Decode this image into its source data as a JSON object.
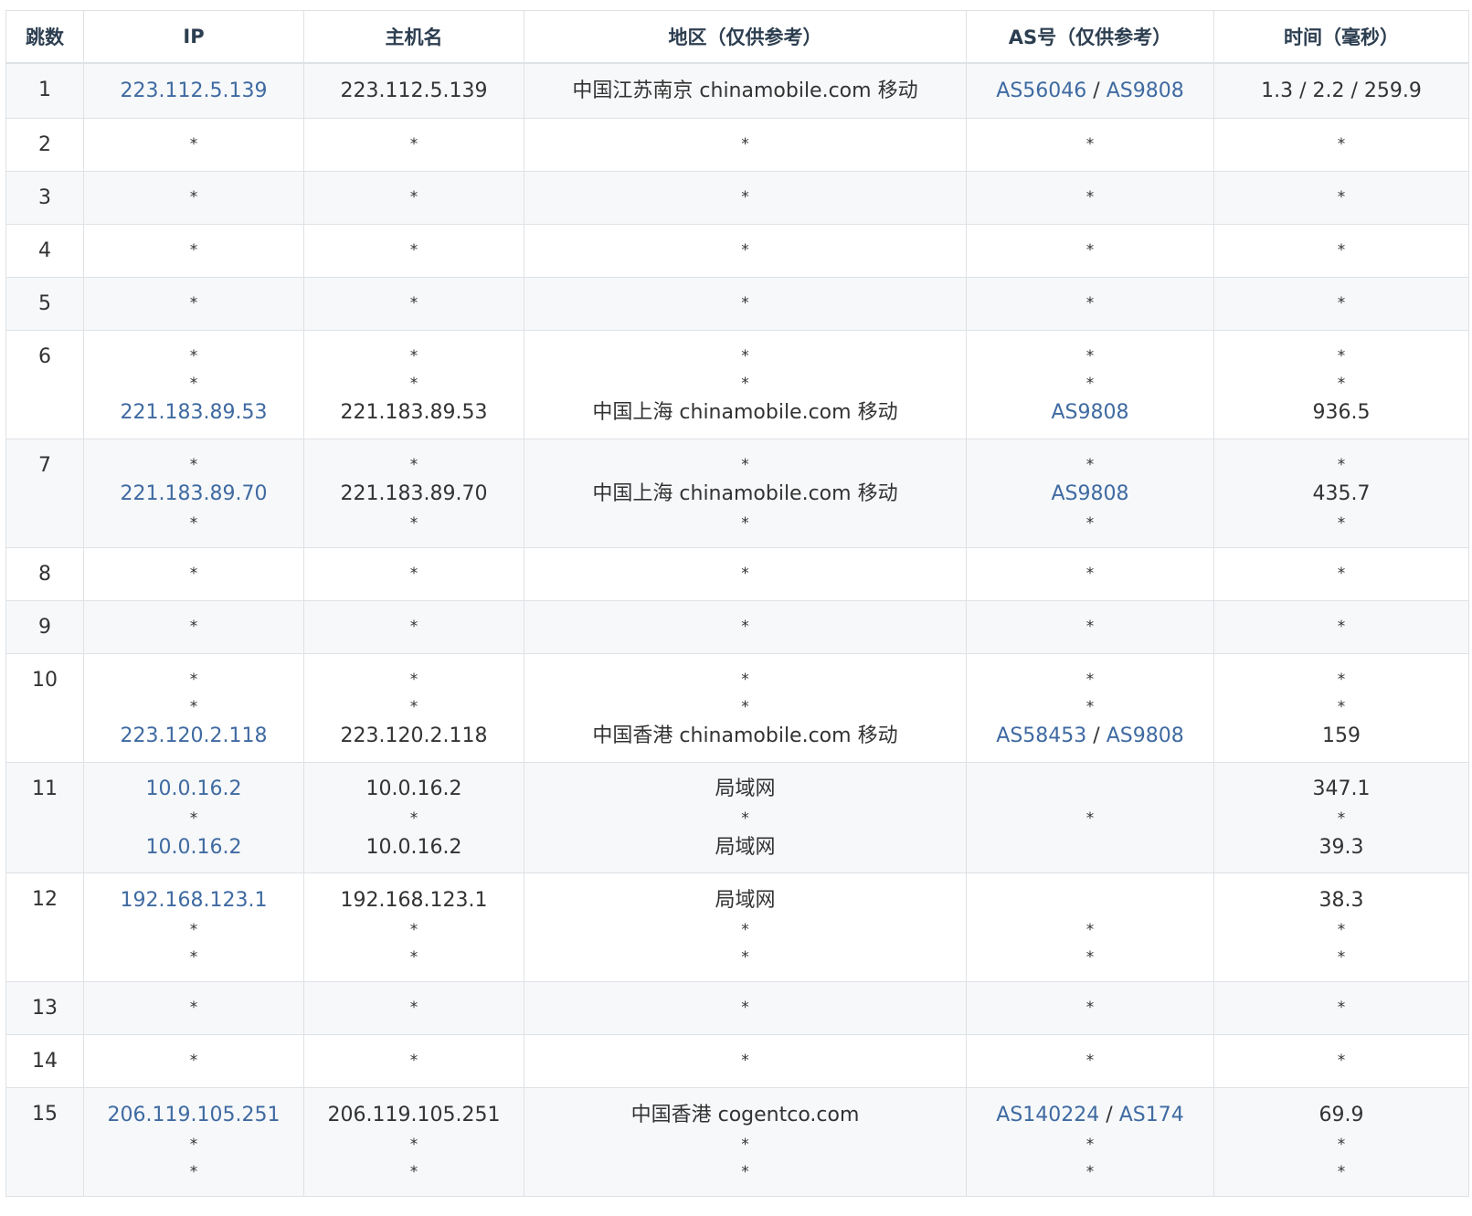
{
  "headers": [
    "跳数",
    "IP",
    "主机名",
    "地区（仅供参考）",
    "AS号（仅供参考）",
    "时间（毫秒）"
  ],
  "colors": {
    "link": "#3f6aa1",
    "text": "#333333",
    "header": "#2c3e50",
    "stripe": "#f6f8fa",
    "border": "#dfe2e5"
  },
  "rows": [
    {
      "hop": "1",
      "ip": [
        [
          "223.112.5.139"
        ]
      ],
      "host": [
        [
          "223.112.5.139"
        ]
      ],
      "region": [
        [
          "中国江苏南京 chinamobile.com 移动"
        ]
      ],
      "as": [
        [
          "AS56046",
          "AS9808"
        ]
      ],
      "time": [
        [
          "1.3 / 2.2 / 259.9"
        ]
      ]
    },
    {
      "hop": "2",
      "ip": [
        [
          "*"
        ]
      ],
      "host": [
        [
          "*"
        ]
      ],
      "region": [
        [
          "*"
        ]
      ],
      "as": [
        [
          "*"
        ]
      ],
      "time": [
        [
          "*"
        ]
      ]
    },
    {
      "hop": "3",
      "ip": [
        [
          "*"
        ]
      ],
      "host": [
        [
          "*"
        ]
      ],
      "region": [
        [
          "*"
        ]
      ],
      "as": [
        [
          "*"
        ]
      ],
      "time": [
        [
          "*"
        ]
      ]
    },
    {
      "hop": "4",
      "ip": [
        [
          "*"
        ]
      ],
      "host": [
        [
          "*"
        ]
      ],
      "region": [
        [
          "*"
        ]
      ],
      "as": [
        [
          "*"
        ]
      ],
      "time": [
        [
          "*"
        ]
      ]
    },
    {
      "hop": "5",
      "ip": [
        [
          "*"
        ]
      ],
      "host": [
        [
          "*"
        ]
      ],
      "region": [
        [
          "*"
        ]
      ],
      "as": [
        [
          "*"
        ]
      ],
      "time": [
        [
          "*"
        ]
      ]
    },
    {
      "hop": "6",
      "ip": [
        [
          "*"
        ],
        [
          "*"
        ],
        [
          "221.183.89.53"
        ]
      ],
      "host": [
        [
          "*"
        ],
        [
          "*"
        ],
        [
          "221.183.89.53"
        ]
      ],
      "region": [
        [
          "*"
        ],
        [
          "*"
        ],
        [
          "中国上海 chinamobile.com 移动"
        ]
      ],
      "as": [
        [
          "*"
        ],
        [
          "*"
        ],
        [
          "AS9808"
        ]
      ],
      "time": [
        [
          "*"
        ],
        [
          "*"
        ],
        [
          "936.5"
        ]
      ]
    },
    {
      "hop": "7",
      "ip": [
        [
          "*"
        ],
        [
          "221.183.89.70"
        ],
        [
          "*"
        ]
      ],
      "host": [
        [
          "*"
        ],
        [
          "221.183.89.70"
        ],
        [
          "*"
        ]
      ],
      "region": [
        [
          "*"
        ],
        [
          "中国上海 chinamobile.com 移动"
        ],
        [
          "*"
        ]
      ],
      "as": [
        [
          "*"
        ],
        [
          "AS9808"
        ],
        [
          "*"
        ]
      ],
      "time": [
        [
          "*"
        ],
        [
          "435.7"
        ],
        [
          "*"
        ]
      ]
    },
    {
      "hop": "8",
      "ip": [
        [
          "*"
        ]
      ],
      "host": [
        [
          "*"
        ]
      ],
      "region": [
        [
          "*"
        ]
      ],
      "as": [
        [
          "*"
        ]
      ],
      "time": [
        [
          "*"
        ]
      ]
    },
    {
      "hop": "9",
      "ip": [
        [
          "*"
        ]
      ],
      "host": [
        [
          "*"
        ]
      ],
      "region": [
        [
          "*"
        ]
      ],
      "as": [
        [
          "*"
        ]
      ],
      "time": [
        [
          "*"
        ]
      ]
    },
    {
      "hop": "10",
      "ip": [
        [
          "*"
        ],
        [
          "*"
        ],
        [
          "223.120.2.118"
        ]
      ],
      "host": [
        [
          "*"
        ],
        [
          "*"
        ],
        [
          "223.120.2.118"
        ]
      ],
      "region": [
        [
          "*"
        ],
        [
          "*"
        ],
        [
          "中国香港 chinamobile.com 移动"
        ]
      ],
      "as": [
        [
          "*"
        ],
        [
          "*"
        ],
        [
          "AS58453",
          "AS9808"
        ]
      ],
      "time": [
        [
          "*"
        ],
        [
          "*"
        ],
        [
          "159"
        ]
      ]
    },
    {
      "hop": "11",
      "ip": [
        [
          "10.0.16.2"
        ],
        [
          "*"
        ],
        [
          "10.0.16.2"
        ]
      ],
      "host": [
        [
          "10.0.16.2"
        ],
        [
          "*"
        ],
        [
          "10.0.16.2"
        ]
      ],
      "region": [
        [
          "局域网"
        ],
        [
          "*"
        ],
        [
          "局域网"
        ]
      ],
      "as": [
        [
          ""
        ],
        [
          "*"
        ],
        [
          ""
        ]
      ],
      "time": [
        [
          "347.1"
        ],
        [
          "*"
        ],
        [
          "39.3"
        ]
      ]
    },
    {
      "hop": "12",
      "ip": [
        [
          "192.168.123.1"
        ],
        [
          "*"
        ],
        [
          "*"
        ]
      ],
      "host": [
        [
          "192.168.123.1"
        ],
        [
          "*"
        ],
        [
          "*"
        ]
      ],
      "region": [
        [
          "局域网"
        ],
        [
          "*"
        ],
        [
          "*"
        ]
      ],
      "as": [
        [
          ""
        ],
        [
          "*"
        ],
        [
          "*"
        ]
      ],
      "time": [
        [
          "38.3"
        ],
        [
          "*"
        ],
        [
          "*"
        ]
      ]
    },
    {
      "hop": "13",
      "ip": [
        [
          "*"
        ]
      ],
      "host": [
        [
          "*"
        ]
      ],
      "region": [
        [
          "*"
        ]
      ],
      "as": [
        [
          "*"
        ]
      ],
      "time": [
        [
          "*"
        ]
      ]
    },
    {
      "hop": "14",
      "ip": [
        [
          "*"
        ]
      ],
      "host": [
        [
          "*"
        ]
      ],
      "region": [
        [
          "*"
        ]
      ],
      "as": [
        [
          "*"
        ]
      ],
      "time": [
        [
          "*"
        ]
      ]
    },
    {
      "hop": "15",
      "ip": [
        [
          "206.119.105.251"
        ],
        [
          "*"
        ],
        [
          "*"
        ]
      ],
      "host": [
        [
          "206.119.105.251"
        ],
        [
          "*"
        ],
        [
          "*"
        ]
      ],
      "region": [
        [
          "中国香港 cogentco.com"
        ],
        [
          "*"
        ],
        [
          "*"
        ]
      ],
      "as": [
        [
          "AS140224",
          "AS174"
        ],
        [
          "*"
        ],
        [
          "*"
        ]
      ],
      "time": [
        [
          "69.9"
        ],
        [
          "*"
        ],
        [
          "*"
        ]
      ]
    }
  ]
}
